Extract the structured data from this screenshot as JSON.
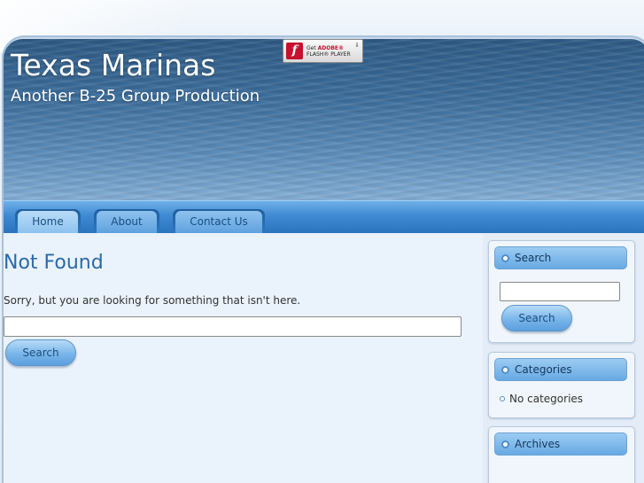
{
  "site": {
    "title": "Texas Marinas",
    "tagline": "Another B-25 Group Production"
  },
  "flash_badge": {
    "line1_prefix": "Get ",
    "line1_brand": "ADOBE®",
    "line2": "FLASH® PLAYER",
    "icon": "flash-player-icon"
  },
  "nav": {
    "tabs": [
      {
        "label": "Home",
        "active": true
      },
      {
        "label": "About",
        "active": false
      },
      {
        "label": "Contact Us",
        "active": false
      }
    ]
  },
  "main": {
    "heading": "Not Found",
    "message": "Sorry, but you are looking for something that isn't here.",
    "search_value": "",
    "search_button": "Search"
  },
  "sidebar": {
    "search": {
      "title": "Search",
      "input_value": "",
      "button": "Search"
    },
    "categories": {
      "title": "Categories",
      "items": [
        "No categories"
      ]
    },
    "archives": {
      "title": "Archives"
    }
  },
  "colors": {
    "accent": "#2a6aa8",
    "nav_blue": "#3f8ad2",
    "widget_bar": "#67a9e3"
  }
}
